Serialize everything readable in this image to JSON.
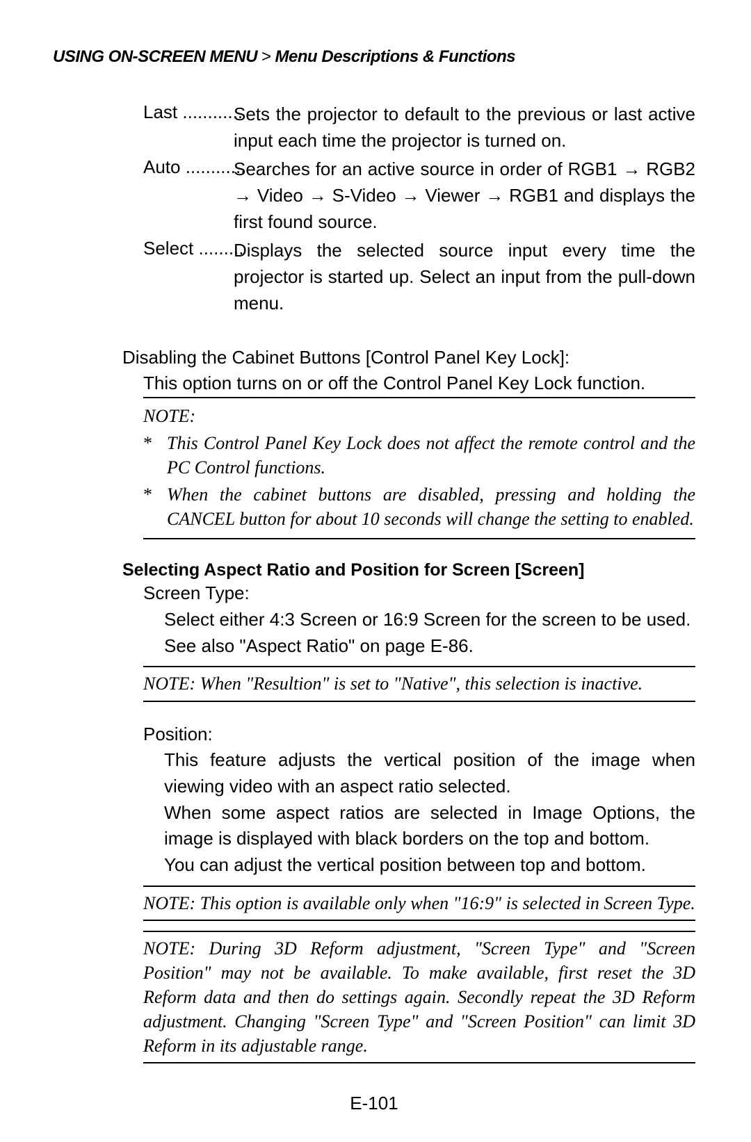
{
  "header": {
    "section": "USING ON-SCREEN MENU",
    "separator": ">",
    "subsection": "Menu Descriptions & Functions"
  },
  "defs": {
    "last": {
      "term": "Last ............",
      "desc": "Sets the projector to default to the previous or last active input each time the projector is turned on."
    },
    "auto": {
      "term": "Auto ............",
      "desc": "Searches for an active source in order of RGB1 → RGB2 → Video → S-Video → Viewer → RGB1 and displays the first found source."
    },
    "select": {
      "term": "Select .........",
      "desc": "Displays the selected source input every time the projector is started up. Select an input from the pull-down menu."
    }
  },
  "cabinet": {
    "title": "Disabling the Cabinet Buttons [Control Panel Key Lock]:",
    "desc": "This option turns on or off the Control Panel Key Lock function."
  },
  "note1": {
    "label": "NOTE:",
    "b1": "This Control Panel Key Lock does not affect the remote control and the PC Control functions.",
    "b2": "When the cabinet buttons are disabled, pressing and holding the CANCEL button for about 10 seconds will change the setting to enabled."
  },
  "screen": {
    "heading": "Selecting Aspect Ratio and Position for Screen [Screen]",
    "type_label": "Screen Type:",
    "type_desc": "Select either 4:3 Screen or 16:9 Screen for the screen to be used. See also \"Aspect Ratio\" on page E-86.",
    "note_native": "NOTE: When \"Resultion\" is set to \"Native\", this selection is inactive.",
    "position_label": "Position:",
    "position_p1": "This feature adjusts the vertical position of the image when viewing video with an aspect ratio selected.",
    "position_p2": "When some aspect ratios are selected in Image Options, the image is displayed with black borders on the top and bottom.",
    "position_p3": "You can adjust the vertical position between top and bottom.",
    "note_169": "NOTE: This option is available only when \"16:9\" is selected in Screen Type.",
    "note_3d": "NOTE: During 3D Reform adjustment, \"Screen Type\" and \"Screen Position\" may not be available. To make available, first reset the 3D Reform data and then do settings again. Secondly repeat the 3D Reform adjustment. Changing \"Screen Type\" and \"Screen Position\" can limit 3D Reform in its adjustable range."
  },
  "page_number": "E-101"
}
